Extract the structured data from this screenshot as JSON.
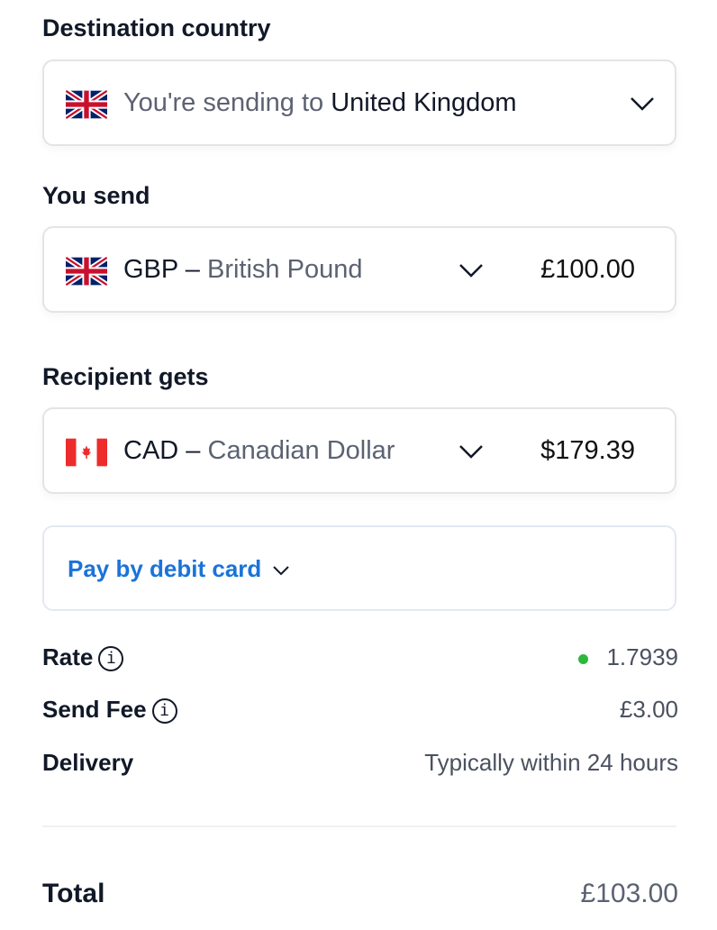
{
  "destination": {
    "label": "Destination country",
    "prefix": "You're sending to",
    "country": "United Kingdom",
    "flag": "uk-flag-icon"
  },
  "send": {
    "label": "You send",
    "code": "GBP",
    "separator": "–",
    "name": "British Pound",
    "amount": "£100.00",
    "flag": "uk-flag-icon"
  },
  "receive": {
    "label": "Recipient gets",
    "code": "CAD",
    "separator": "–",
    "name": "Canadian Dollar",
    "amount": "$179.39",
    "flag": "canada-flag-icon"
  },
  "payment": {
    "label": "Pay by debit card"
  },
  "details": {
    "rate_label": "Rate",
    "rate_value": "1.7939",
    "rate_status_color": "#2db83d",
    "fee_label": "Send Fee",
    "fee_value": "£3.00",
    "delivery_label": "Delivery",
    "delivery_value": "Typically within 24 hours",
    "info_glyph": "i"
  },
  "total": {
    "label": "Total",
    "value": "£103.00"
  },
  "colors": {
    "accent": "#1a73d9",
    "text": "#111827",
    "muted": "#5b6272"
  }
}
